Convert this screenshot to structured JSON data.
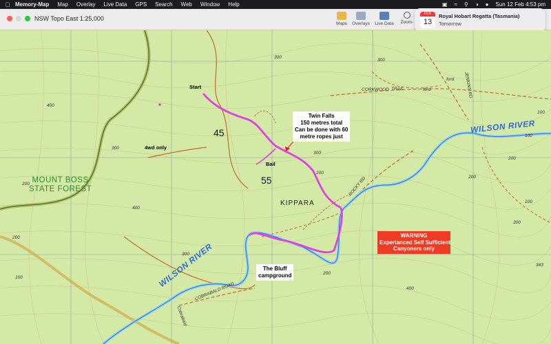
{
  "menubar": {
    "app_name": "Memory-Map",
    "items": [
      "Map",
      "Overlay",
      "Live Data",
      "GPS",
      "Search",
      "Web",
      "Window",
      "Help"
    ],
    "clock": "Sun 12 Feb  4:53 pm"
  },
  "window": {
    "title": "NSW Topo East 1:25,000",
    "toolbar": [
      "Maps",
      "Overlays",
      "Live Data",
      "Zoom-"
    ]
  },
  "notification": {
    "month": "FEB",
    "day": "13",
    "title": "Royal Hobart Regatta (Tasmania)",
    "subtitle": "Tomorrow"
  },
  "map": {
    "start_label": "Start",
    "bail_label": "Bail",
    "twin_falls": [
      "Twin Falls",
      "150 metres total",
      "Can be done with 60",
      "metre ropes just"
    ],
    "grid_45": "45",
    "grid_55": "55",
    "fourwd": "4wd only",
    "region": [
      "MOUNT BOSS",
      "STATE  FOREST"
    ],
    "kippara": "KIPPARA",
    "river_label": "WILSON   RIVER",
    "bluff": [
      "The Bluff",
      "campground"
    ],
    "warning": [
      "WARNING",
      "Experianced Self Sufficient",
      "Canyoners only"
    ],
    "roads": {
      "corkwood": "CORKWOOD",
      "trail": "TRAIL",
      "ford1": "ford",
      "ford2": "ford",
      "jenkins": "JENKINS  RD",
      "rocky": "ROCKY  RD",
      "cobrabald_rd": "COBRABALD  ROAD",
      "cobrabald": "Cobrabald"
    },
    "contours": [
      "400",
      "300",
      "200",
      "300",
      "200",
      "300",
      "200",
      "100",
      "200",
      "100",
      "300",
      "400",
      "200",
      "100",
      "300",
      "200",
      "400",
      "100",
      "300",
      "343"
    ]
  }
}
